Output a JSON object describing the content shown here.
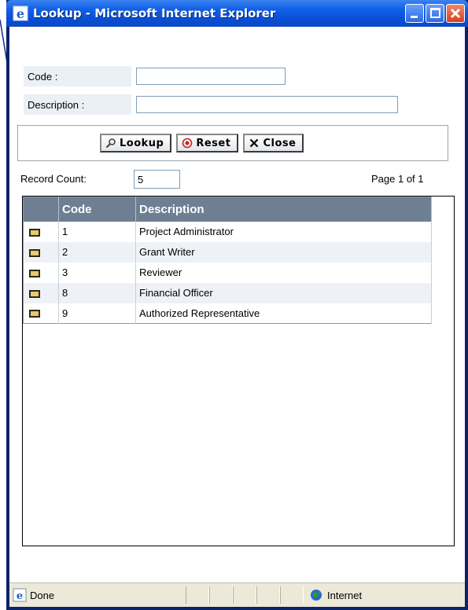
{
  "window": {
    "title": "Lookup - Microsoft Internet Explorer"
  },
  "form": {
    "code_label": "Code :",
    "code_value": "",
    "description_label": "Description :",
    "description_value": ""
  },
  "buttons": {
    "lookup": "Lookup",
    "reset": "Reset",
    "close": "Close"
  },
  "results": {
    "record_count_label": "Record Count:",
    "record_count_value": "5",
    "page_info": "Page 1 of 1",
    "columns": [
      "Code",
      "Description"
    ],
    "rows": [
      {
        "code": "1",
        "description": "Project Administrator"
      },
      {
        "code": "2",
        "description": "Grant Writer"
      },
      {
        "code": "3",
        "description": "Reviewer"
      },
      {
        "code": "8",
        "description": "Financial Officer"
      },
      {
        "code": "9",
        "description": "Authorized Representative"
      }
    ]
  },
  "status": {
    "left": "Done",
    "zone": "Internet"
  },
  "icons": {
    "title": "ie-icon",
    "lookup": "magnifier-icon",
    "reset": "reset-icon",
    "close": "x-icon",
    "row_select": "select-row-icon",
    "status": "ie-page-icon",
    "zone": "globe-icon"
  },
  "colors": {
    "titlebar": "#0b48c4",
    "grid_header": "#6e7f93",
    "label_bg": "#eaf0f6",
    "reset_red": "#cc2222"
  }
}
